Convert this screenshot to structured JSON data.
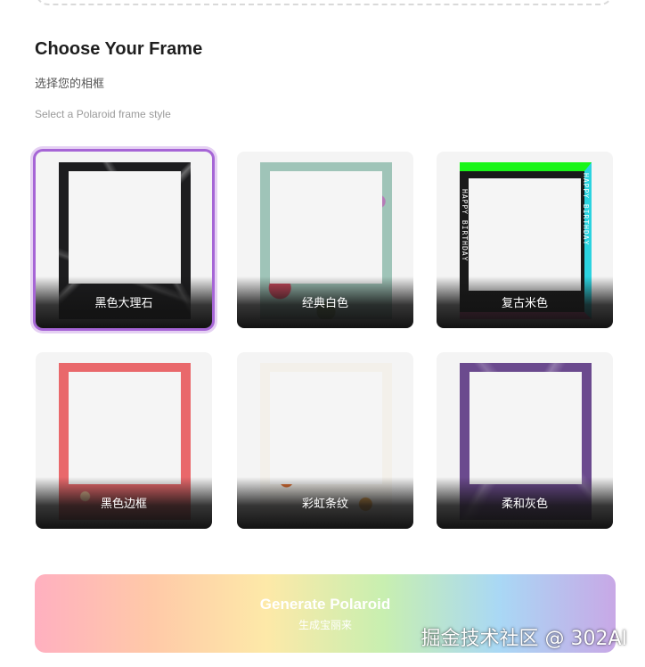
{
  "header": {
    "title": "Choose Your Frame",
    "subtitle": "选择您的相框",
    "hint": "Select a Polaroid frame style"
  },
  "frames": [
    {
      "label": "黑色大理石",
      "selected": true
    },
    {
      "label": "经典白色",
      "selected": false
    },
    {
      "label": "复古米色",
      "selected": false
    },
    {
      "label": "黑色边框",
      "selected": false
    },
    {
      "label": "彩虹条纹",
      "selected": false
    },
    {
      "label": "柔和灰色",
      "selected": false
    }
  ],
  "retro_frame_text": "HAPPY BIRTHDAY",
  "generate": {
    "label": "Generate Polaroid",
    "sublabel": "生成宝丽来"
  },
  "watermark": "掘金技术社区 @ 302AI",
  "colors": {
    "selected_border": "#a665d6",
    "button_gradient": [
      "#ffb0c0",
      "#fde9a8",
      "#c8efb0",
      "#a9d8f5",
      "#c8a8e6"
    ]
  }
}
